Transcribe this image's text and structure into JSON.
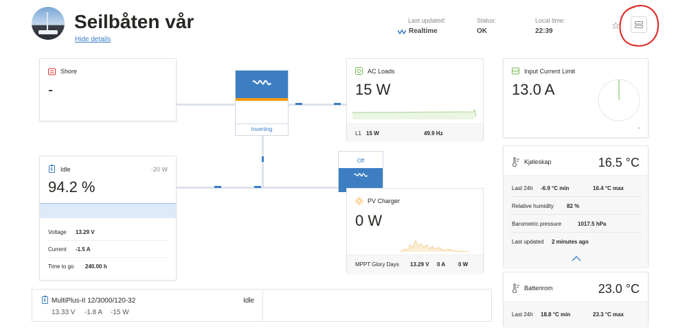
{
  "header": {
    "title": "Seilbåten vår",
    "hide_details": "Hide details",
    "last_updated_label": "Last updated:",
    "last_updated_value": "Realtime",
    "status_label": "Status:",
    "status_value": "OK",
    "local_time_label": "Local time:",
    "local_time_value": "22:39"
  },
  "shore": {
    "title": "Shore",
    "value": "-"
  },
  "inverter": {
    "state": "Inverting"
  },
  "ac_loads": {
    "title": "AC Loads",
    "value": "15 W",
    "l1": "L1",
    "l1_power": "15 W",
    "freq": "49.9 Hz"
  },
  "input_limit": {
    "title": "Input Current Limit",
    "value": "13.0 A",
    "dash": "-",
    "fraction": 0.0
  },
  "battery": {
    "state": "Idle",
    "power": "-20 W",
    "soc": "94.2 %",
    "soc_fraction": 0.942,
    "voltage_label": "Voltage",
    "voltage": "13.29 V",
    "current_label": "Current",
    "current": "-1.5 A",
    "ttg_label": "Time to go",
    "ttg": "240.00 h"
  },
  "pv_switch": {
    "state": "Off"
  },
  "pv_charger": {
    "title": "PV Charger",
    "value": "0 W",
    "footer_name": "MPPT Glory Days",
    "footer_v": "13.29 V",
    "footer_a": "0 A",
    "footer_w": "0 W"
  },
  "fridge": {
    "title": "Kjøleskap",
    "temp": "16.5 °C",
    "last24_label": "Last 24h",
    "min": "-6.9 °C min",
    "max": "16.4 °C max",
    "hum_label": "Relative humidity",
    "hum": "82 %",
    "baro_label": "Barometric pressure",
    "baro": "1017.5 hPa",
    "updated_label": "Last updated",
    "updated": "2 minutes ago"
  },
  "batt_room": {
    "title": "Batterirom",
    "temp": "23.0 °C",
    "last24_label": "Last 24h",
    "min": "18.8 °C min",
    "max": "23.3 °C max"
  },
  "multiplus": {
    "name": "MultiPlus-II 12/3000/120-32",
    "state": "Idle",
    "v": "13.33 V",
    "a": "-1.8 A",
    "w": "-15 W"
  },
  "colors": {
    "accent": "#387dc5",
    "green": "#72b84c",
    "orange": "#f39c12",
    "red": "#e0312e"
  }
}
